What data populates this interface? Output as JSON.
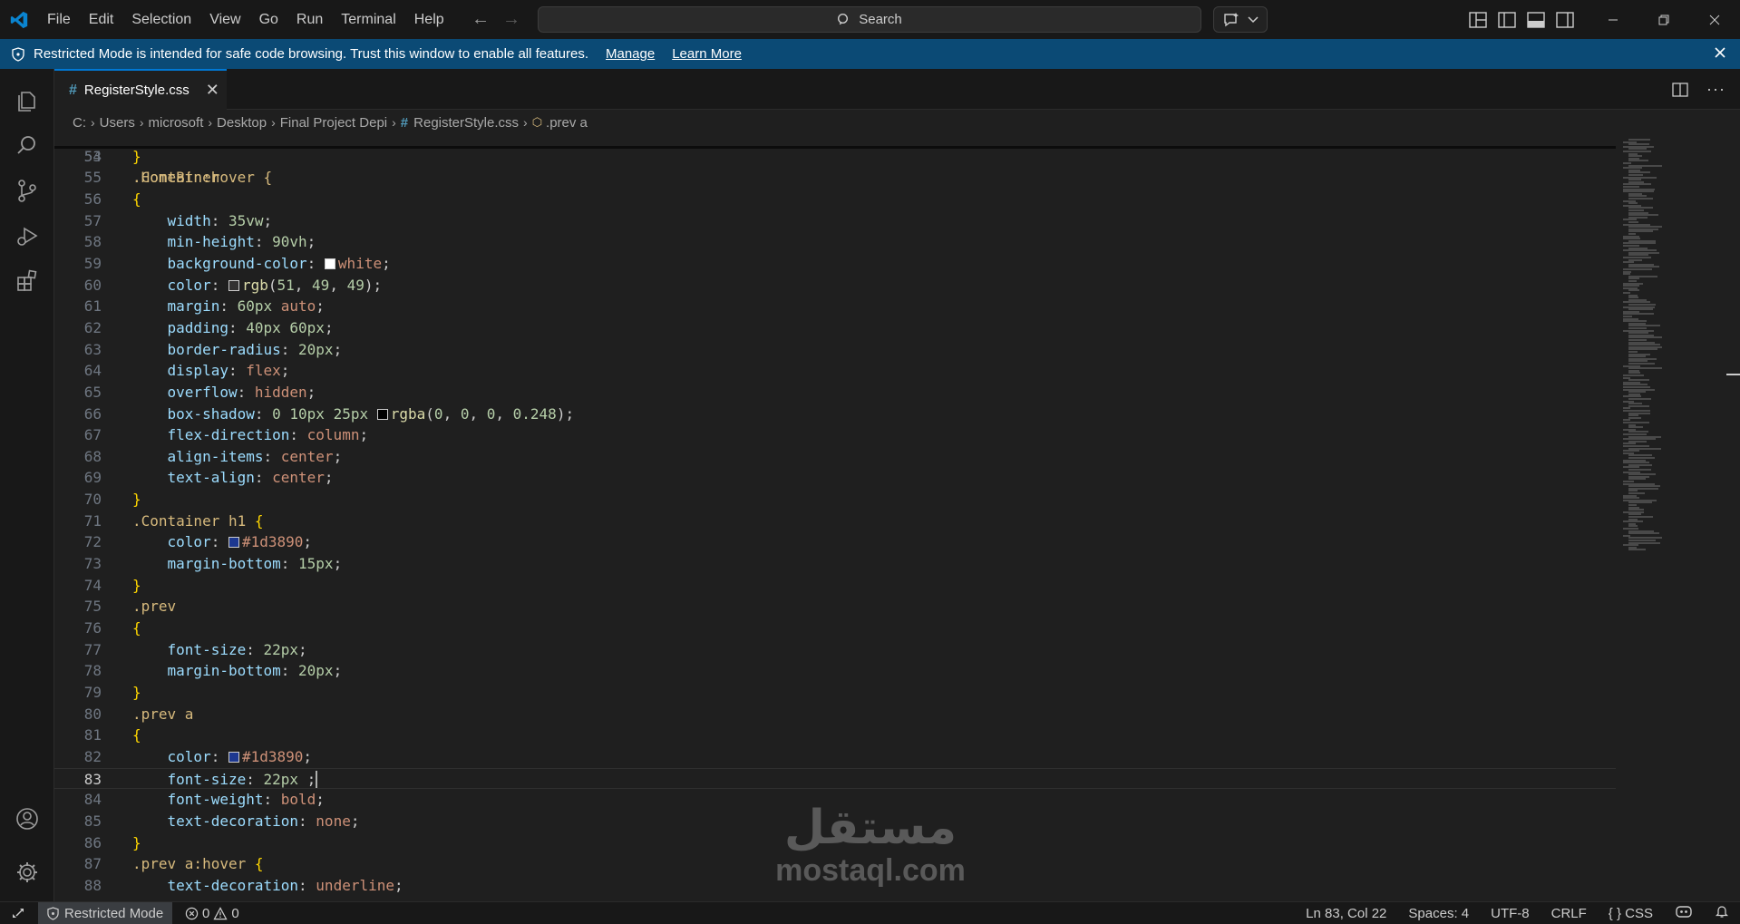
{
  "menu": [
    "File",
    "Edit",
    "Selection",
    "View",
    "Go",
    "Run",
    "Terminal",
    "Help"
  ],
  "search": {
    "label": "Search"
  },
  "banner": {
    "message": "Restricted Mode is intended for safe code browsing. Trust this window to enable all features.",
    "manage": "Manage",
    "learn_more": "Learn More"
  },
  "tab": {
    "label": "RegisterStyle.css",
    "icon": "#"
  },
  "breadcrumb": {
    "items": [
      "C:",
      "Users",
      "microsoft",
      "Desktop",
      "Final Project Depi"
    ],
    "file": "RegisterStyle.css",
    "symbol": ".prev a"
  },
  "editor": {
    "partial_line": ".HomeBtn:hover {",
    "partial_line_number": "53",
    "current_line": "83",
    "lines": [
      {
        "n": "54",
        "t": [
          [
            "brace",
            "}"
          ]
        ]
      },
      {
        "n": "55",
        "t": [
          [
            "sel",
            ".Container"
          ]
        ]
      },
      {
        "n": "56",
        "t": [
          [
            "brace",
            "{"
          ]
        ]
      },
      {
        "n": "57",
        "t": [
          [
            "ws",
            "    "
          ],
          [
            "prop",
            "width"
          ],
          [
            "punct",
            ": "
          ],
          [
            "num",
            "35vw"
          ],
          [
            "punct",
            ";"
          ]
        ]
      },
      {
        "n": "58",
        "t": [
          [
            "ws",
            "    "
          ],
          [
            "prop",
            "min-height"
          ],
          [
            "punct",
            ": "
          ],
          [
            "num",
            "90vh"
          ],
          [
            "punct",
            ";"
          ]
        ]
      },
      {
        "n": "59",
        "t": [
          [
            "ws",
            "    "
          ],
          [
            "prop",
            "background-color"
          ],
          [
            "punct",
            ": "
          ],
          [
            "swatch",
            "#ffffff"
          ],
          [
            "val",
            "white"
          ],
          [
            "punct",
            ";"
          ]
        ]
      },
      {
        "n": "60",
        "t": [
          [
            "ws",
            "    "
          ],
          [
            "prop",
            "color"
          ],
          [
            "punct",
            ": "
          ],
          [
            "swatch",
            "#333131"
          ],
          [
            "fn",
            "rgb"
          ],
          [
            "punct",
            "("
          ],
          [
            "num",
            "51"
          ],
          [
            "punct",
            ", "
          ],
          [
            "num",
            "49"
          ],
          [
            "punct",
            ", "
          ],
          [
            "num",
            "49"
          ],
          [
            "punct",
            ");"
          ]
        ]
      },
      {
        "n": "61",
        "t": [
          [
            "ws",
            "    "
          ],
          [
            "prop",
            "margin"
          ],
          [
            "punct",
            ": "
          ],
          [
            "num",
            "60px"
          ],
          [
            "punct",
            " "
          ],
          [
            "val",
            "auto"
          ],
          [
            "punct",
            ";"
          ]
        ]
      },
      {
        "n": "62",
        "t": [
          [
            "ws",
            "    "
          ],
          [
            "prop",
            "padding"
          ],
          [
            "punct",
            ": "
          ],
          [
            "num",
            "40px"
          ],
          [
            "punct",
            " "
          ],
          [
            "num",
            "60px"
          ],
          [
            "punct",
            ";"
          ]
        ]
      },
      {
        "n": "63",
        "t": [
          [
            "ws",
            "    "
          ],
          [
            "prop",
            "border-radius"
          ],
          [
            "punct",
            ": "
          ],
          [
            "num",
            "20px"
          ],
          [
            "punct",
            ";"
          ]
        ]
      },
      {
        "n": "64",
        "t": [
          [
            "ws",
            "    "
          ],
          [
            "prop",
            "display"
          ],
          [
            "punct",
            ": "
          ],
          [
            "val",
            "flex"
          ],
          [
            "punct",
            ";"
          ]
        ]
      },
      {
        "n": "65",
        "t": [
          [
            "ws",
            "    "
          ],
          [
            "prop",
            "overflow"
          ],
          [
            "punct",
            ": "
          ],
          [
            "val",
            "hidden"
          ],
          [
            "punct",
            ";"
          ]
        ]
      },
      {
        "n": "66",
        "t": [
          [
            "ws",
            "    "
          ],
          [
            "prop",
            "box-shadow"
          ],
          [
            "punct",
            ": "
          ],
          [
            "num",
            "0"
          ],
          [
            "punct",
            " "
          ],
          [
            "num",
            "10px"
          ],
          [
            "punct",
            " "
          ],
          [
            "num",
            "25px"
          ],
          [
            "punct",
            " "
          ],
          [
            "swatch",
            "#000000"
          ],
          [
            "fn",
            "rgba"
          ],
          [
            "punct",
            "("
          ],
          [
            "num",
            "0"
          ],
          [
            "punct",
            ", "
          ],
          [
            "num",
            "0"
          ],
          [
            "punct",
            ", "
          ],
          [
            "num",
            "0"
          ],
          [
            "punct",
            ", "
          ],
          [
            "num",
            "0.248"
          ],
          [
            "punct",
            ");"
          ]
        ]
      },
      {
        "n": "67",
        "t": [
          [
            "ws",
            "    "
          ],
          [
            "prop",
            "flex-direction"
          ],
          [
            "punct",
            ": "
          ],
          [
            "val",
            "column"
          ],
          [
            "punct",
            ";"
          ]
        ]
      },
      {
        "n": "68",
        "t": [
          [
            "ws",
            "    "
          ],
          [
            "prop",
            "align-items"
          ],
          [
            "punct",
            ": "
          ],
          [
            "val",
            "center"
          ],
          [
            "punct",
            ";"
          ]
        ]
      },
      {
        "n": "69",
        "t": [
          [
            "ws",
            "    "
          ],
          [
            "prop",
            "text-align"
          ],
          [
            "punct",
            ": "
          ],
          [
            "val",
            "center"
          ],
          [
            "punct",
            ";"
          ]
        ]
      },
      {
        "n": "70",
        "t": [
          [
            "brace",
            "}"
          ]
        ]
      },
      {
        "n": "71",
        "t": [
          [
            "sel",
            ".Container h1 "
          ],
          [
            "brace",
            "{"
          ]
        ]
      },
      {
        "n": "72",
        "t": [
          [
            "ws",
            "    "
          ],
          [
            "prop",
            "color"
          ],
          [
            "punct",
            ": "
          ],
          [
            "swatch",
            "#1d3890"
          ],
          [
            "val",
            "#1d3890"
          ],
          [
            "punct",
            ";"
          ]
        ]
      },
      {
        "n": "73",
        "t": [
          [
            "ws",
            "    "
          ],
          [
            "prop",
            "margin-bottom"
          ],
          [
            "punct",
            ": "
          ],
          [
            "num",
            "15px"
          ],
          [
            "punct",
            ";"
          ]
        ]
      },
      {
        "n": "74",
        "t": [
          [
            "brace",
            "}"
          ]
        ]
      },
      {
        "n": "75",
        "t": [
          [
            "sel",
            ".prev"
          ]
        ]
      },
      {
        "n": "76",
        "t": [
          [
            "brace",
            "{"
          ]
        ]
      },
      {
        "n": "77",
        "t": [
          [
            "ws",
            "    "
          ],
          [
            "prop",
            "font-size"
          ],
          [
            "punct",
            ": "
          ],
          [
            "num",
            "22px"
          ],
          [
            "punct",
            ";"
          ]
        ]
      },
      {
        "n": "78",
        "t": [
          [
            "ws",
            "    "
          ],
          [
            "prop",
            "margin-bottom"
          ],
          [
            "punct",
            ": "
          ],
          [
            "num",
            "20px"
          ],
          [
            "punct",
            ";"
          ]
        ]
      },
      {
        "n": "79",
        "t": [
          [
            "brace",
            "}"
          ]
        ]
      },
      {
        "n": "80",
        "t": [
          [
            "sel",
            ".prev a"
          ]
        ]
      },
      {
        "n": "81",
        "t": [
          [
            "brace",
            "{"
          ]
        ]
      },
      {
        "n": "82",
        "t": [
          [
            "ws",
            "    "
          ],
          [
            "prop",
            "color"
          ],
          [
            "punct",
            ": "
          ],
          [
            "swatch",
            "#1d3890"
          ],
          [
            "val",
            "#1d3890"
          ],
          [
            "punct",
            ";"
          ]
        ]
      },
      {
        "n": "83",
        "t": [
          [
            "ws",
            "    "
          ],
          [
            "prop",
            "font-size"
          ],
          [
            "punct",
            ": "
          ],
          [
            "num",
            "22px"
          ],
          [
            "punct",
            " ;"
          ],
          [
            "caret",
            ""
          ]
        ]
      },
      {
        "n": "84",
        "t": [
          [
            "ws",
            "    "
          ],
          [
            "prop",
            "font-weight"
          ],
          [
            "punct",
            ": "
          ],
          [
            "val",
            "bold"
          ],
          [
            "punct",
            ";"
          ]
        ]
      },
      {
        "n": "85",
        "t": [
          [
            "ws",
            "    "
          ],
          [
            "prop",
            "text-decoration"
          ],
          [
            "punct",
            ": "
          ],
          [
            "val",
            "none"
          ],
          [
            "punct",
            ";"
          ]
        ]
      },
      {
        "n": "86",
        "t": [
          [
            "brace",
            "}"
          ]
        ]
      },
      {
        "n": "87",
        "t": [
          [
            "sel",
            ".prev a:hover "
          ],
          [
            "brace",
            "{"
          ]
        ]
      },
      {
        "n": "88",
        "t": [
          [
            "ws",
            "    "
          ],
          [
            "prop",
            "text-decoration"
          ],
          [
            "punct",
            ": "
          ],
          [
            "val",
            "underline"
          ],
          [
            "punct",
            ";"
          ]
        ]
      }
    ]
  },
  "watermark": {
    "arabic": "مستقل",
    "latin": "mostaql.com"
  },
  "statusbar": {
    "restricted": "Restricted Mode",
    "errors": "0",
    "warnings": "0",
    "position": "Ln 83, Col 22",
    "spaces": "Spaces: 4",
    "encoding": "UTF-8",
    "eol": "CRLF",
    "language": "CSS",
    "language_icon": "{ }"
  },
  "colors": {
    "accent": "#0078d4",
    "banner": "#0b4a75",
    "selector": "#d7ba7d",
    "property": "#9cdcfe",
    "value": "#ce9178",
    "number": "#b5cea8",
    "bracket": "#ffd700"
  }
}
